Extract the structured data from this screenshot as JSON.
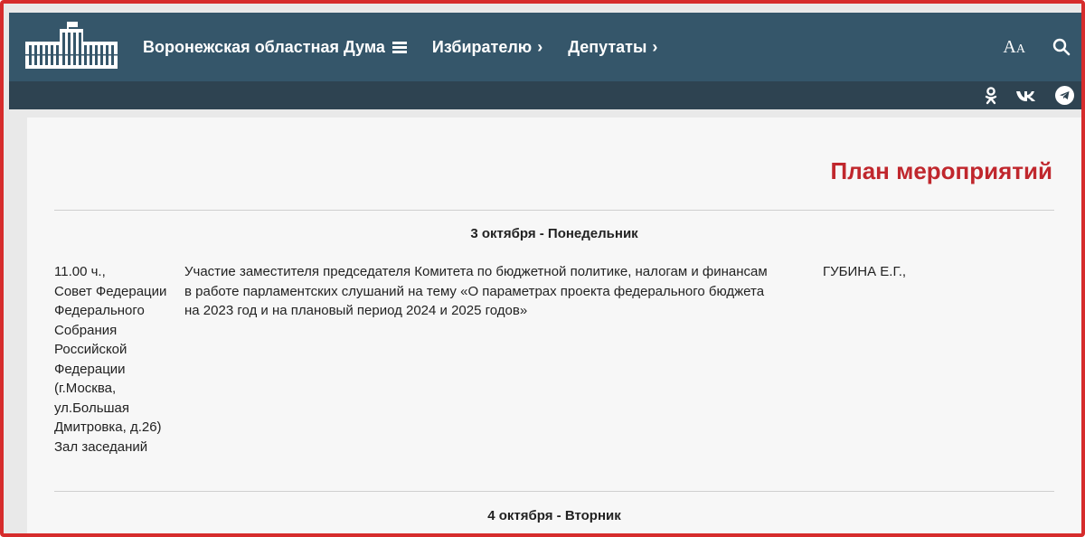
{
  "header": {
    "nav": [
      {
        "label": "Воронежская областная Дума",
        "glyph": "hamburger"
      },
      {
        "label": "Избирателю",
        "glyph": "›"
      },
      {
        "label": "Депутаты",
        "glyph": "›"
      }
    ],
    "font_size_label": {
      "big": "A",
      "small": "A"
    },
    "icons": [
      "font-size-icon",
      "search-icon"
    ],
    "social_icons": [
      "odnoklassniki-icon",
      "vk-icon",
      "telegram-icon"
    ]
  },
  "page": {
    "title": "План мероприятий"
  },
  "days": [
    {
      "heading": "3 октября - Понедельник",
      "events": [
        {
          "time_place": "11.00 ч.,\nСовет Федерации Федерального Собрания Российской Федерации (г.Москва, ул.Большая Дмитровка, д.26)\nЗал заседаний",
          "time_lines": [
            "11.00 ч.,",
            "Совет Федерации",
            "Федерального",
            "Собрания",
            "Российской",
            "Федерации",
            "(г.Москва,",
            "ул.Большая",
            "Дмитровка, д.26)",
            "Зал заседаний"
          ],
          "description": "Участие заместителя председателя Комитета по бюджетной политике, налогам и финансам в работе парламентских слушаний на тему «О параметрах проекта федерального бюджета на 2023 год и на плановый период 2024 и 2025 годов»",
          "participant": "ГУБИНА Е.Г.,"
        }
      ]
    },
    {
      "heading": "4 октября - Вторник",
      "events": []
    }
  ],
  "colors": {
    "header_bg": "#35566a",
    "subbar_bg": "#2e4351",
    "title_red": "#c0272d",
    "frame_red": "#d62c2c"
  }
}
